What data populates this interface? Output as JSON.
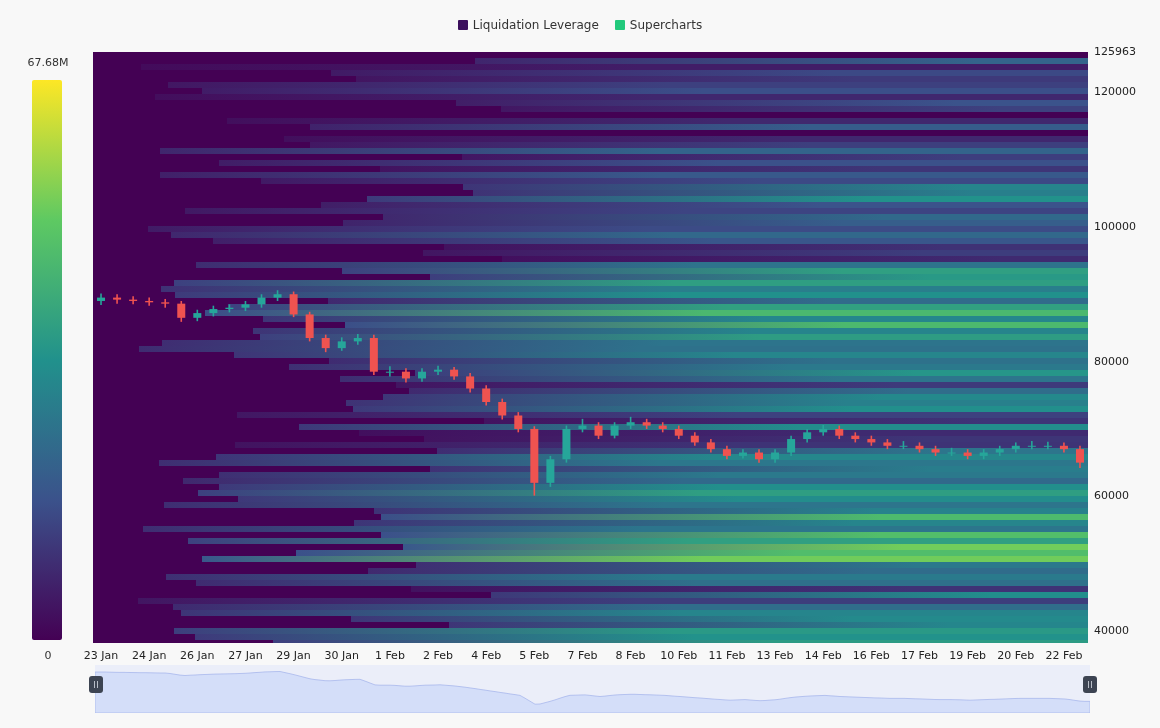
{
  "legend": [
    {
      "label": "Liquidation Leverage",
      "color": "#3b0f5c"
    },
    {
      "label": "Supercharts",
      "color": "#22c97c"
    }
  ],
  "color_scale": {
    "max_label": "67.68M",
    "min_label": "0"
  },
  "chart_data": {
    "type": "candlestick",
    "categories": [
      "23 Jan",
      null,
      null,
      "24 Jan",
      null,
      null,
      "26 Jan",
      null,
      null,
      "27 Jan",
      null,
      null,
      "29 Jan",
      null,
      null,
      "30 Jan",
      null,
      null,
      "1 Feb",
      null,
      null,
      "2 Feb",
      null,
      null,
      "4 Feb",
      null,
      null,
      "5 Feb",
      null,
      null,
      "7 Feb",
      null,
      null,
      "8 Feb",
      null,
      null,
      "10 Feb",
      null,
      null,
      "11 Feb",
      null,
      null,
      "13 Feb",
      null,
      null,
      "14 Feb",
      null,
      null,
      "16 Feb",
      null,
      null,
      "17 Feb",
      null,
      null,
      "19 Feb",
      null,
      null,
      "20 Feb",
      null,
      null,
      "22 Feb",
      null
    ],
    "ylim": [
      38222,
      125963
    ],
    "yticks": [
      {
        "value": 125963,
        "label": "125963"
      },
      {
        "value": 120000,
        "label": "120000"
      },
      {
        "value": 100000,
        "label": "100000"
      },
      {
        "value": 80000,
        "label": "80000"
      },
      {
        "value": 60000,
        "label": "60000"
      },
      {
        "value": 40000,
        "label": "40000"
      }
    ],
    "ohlc": [
      [
        89000,
        90100,
        88400,
        89500
      ],
      [
        89500,
        90000,
        88600,
        89200
      ],
      [
        89200,
        89700,
        88500,
        89000
      ],
      [
        89000,
        89500,
        88300,
        88800
      ],
      [
        88800,
        89300,
        88000,
        88600
      ],
      [
        88600,
        89000,
        85900,
        86500
      ],
      [
        86500,
        87700,
        86000,
        87200
      ],
      [
        87200,
        88300,
        86700,
        87800
      ],
      [
        87800,
        88500,
        87300,
        88000
      ],
      [
        88000,
        89000,
        87500,
        88500
      ],
      [
        88500,
        90000,
        88000,
        89500
      ],
      [
        89500,
        90600,
        89000,
        90000
      ],
      [
        90000,
        90400,
        86600,
        87000
      ],
      [
        87000,
        87400,
        83000,
        83500
      ],
      [
        83500,
        84000,
        81400,
        82000
      ],
      [
        82000,
        83600,
        81600,
        83000
      ],
      [
        83000,
        84100,
        82500,
        83500
      ],
      [
        83500,
        84000,
        78000,
        78500
      ],
      [
        78500,
        79300,
        77800,
        78500
      ],
      [
        78500,
        79000,
        76900,
        77500
      ],
      [
        77500,
        79000,
        77000,
        78500
      ],
      [
        78500,
        79400,
        78000,
        78800
      ],
      [
        78800,
        79200,
        77300,
        77800
      ],
      [
        77800,
        78300,
        75400,
        76000
      ],
      [
        76000,
        76500,
        73500,
        74000
      ],
      [
        74000,
        74500,
        71400,
        72000
      ],
      [
        72000,
        72500,
        69500,
        70000
      ],
      [
        70000,
        70400,
        60100,
        62000
      ],
      [
        62000,
        66000,
        61400,
        65500
      ],
      [
        65500,
        70500,
        65000,
        70000
      ],
      [
        70000,
        71500,
        69500,
        70500
      ],
      [
        70500,
        71000,
        68500,
        69000
      ],
      [
        69000,
        71000,
        68600,
        70500
      ],
      [
        70500,
        71800,
        70000,
        71000
      ],
      [
        71000,
        71500,
        70000,
        70500
      ],
      [
        70500,
        71000,
        69500,
        70000
      ],
      [
        70000,
        70500,
        68500,
        69000
      ],
      [
        69000,
        69500,
        67500,
        68000
      ],
      [
        68000,
        68500,
        66500,
        67000
      ],
      [
        67000,
        67500,
        65500,
        66000
      ],
      [
        66000,
        67000,
        65600,
        66500
      ],
      [
        66500,
        67000,
        65000,
        65500
      ],
      [
        65500,
        67000,
        65000,
        66500
      ],
      [
        66500,
        69000,
        66000,
        68500
      ],
      [
        68500,
        70000,
        68000,
        69500
      ],
      [
        69500,
        70600,
        69000,
        70000
      ],
      [
        70000,
        70500,
        68500,
        69000
      ],
      [
        69000,
        69500,
        68000,
        68500
      ],
      [
        68500,
        69000,
        67500,
        68000
      ],
      [
        68000,
        68500,
        67000,
        67500
      ],
      [
        67500,
        68200,
        67000,
        67500
      ],
      [
        67500,
        68000,
        66500,
        67000
      ],
      [
        67000,
        67500,
        66000,
        66500
      ],
      [
        66500,
        67200,
        66000,
        66500
      ],
      [
        66500,
        67000,
        65500,
        66000
      ],
      [
        66000,
        67000,
        65500,
        66500
      ],
      [
        66500,
        67500,
        66000,
        67000
      ],
      [
        67000,
        68000,
        66500,
        67500
      ],
      [
        67500,
        68200,
        67000,
        67500
      ],
      [
        67500,
        68100,
        67000,
        67500
      ],
      [
        67500,
        68000,
        66500,
        67000
      ],
      [
        67000,
        67500,
        64200,
        65000
      ]
    ]
  }
}
